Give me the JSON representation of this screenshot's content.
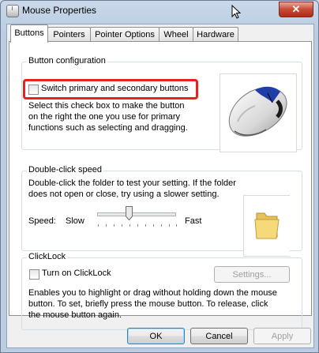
{
  "window": {
    "title": "Mouse Properties",
    "close_glyph": "✕"
  },
  "tabs": [
    {
      "label": "Buttons",
      "active": true
    },
    {
      "label": "Pointers"
    },
    {
      "label": "Pointer Options"
    },
    {
      "label": "Wheel"
    },
    {
      "label": "Hardware"
    }
  ],
  "button_config": {
    "title": "Button configuration",
    "checkbox_label": "Switch primary and secondary buttons",
    "checked": false,
    "description": "Select this check box to make the button on the right the one you use for primary functions such as selecting and dragging."
  },
  "double_click": {
    "title": "Double-click speed",
    "description": "Double-click the folder to test your setting. If the folder does not open or close, try using a slower setting.",
    "speed_label": "Speed:",
    "slow_label": "Slow",
    "fast_label": "Fast",
    "speed_level": 0.4
  },
  "clicklock": {
    "title": "ClickLock",
    "checkbox_label": "Turn on ClickLock",
    "checked": false,
    "settings_label": "Settings...",
    "description": "Enables you to highlight or drag without holding down the mouse button. To set, briefly press the mouse button. To release, click the mouse button again."
  },
  "footer": {
    "ok": "OK",
    "cancel": "Cancel",
    "apply": "Apply"
  },
  "colors": {
    "highlight": "#e8231f",
    "accent": "#3c7fb1"
  }
}
